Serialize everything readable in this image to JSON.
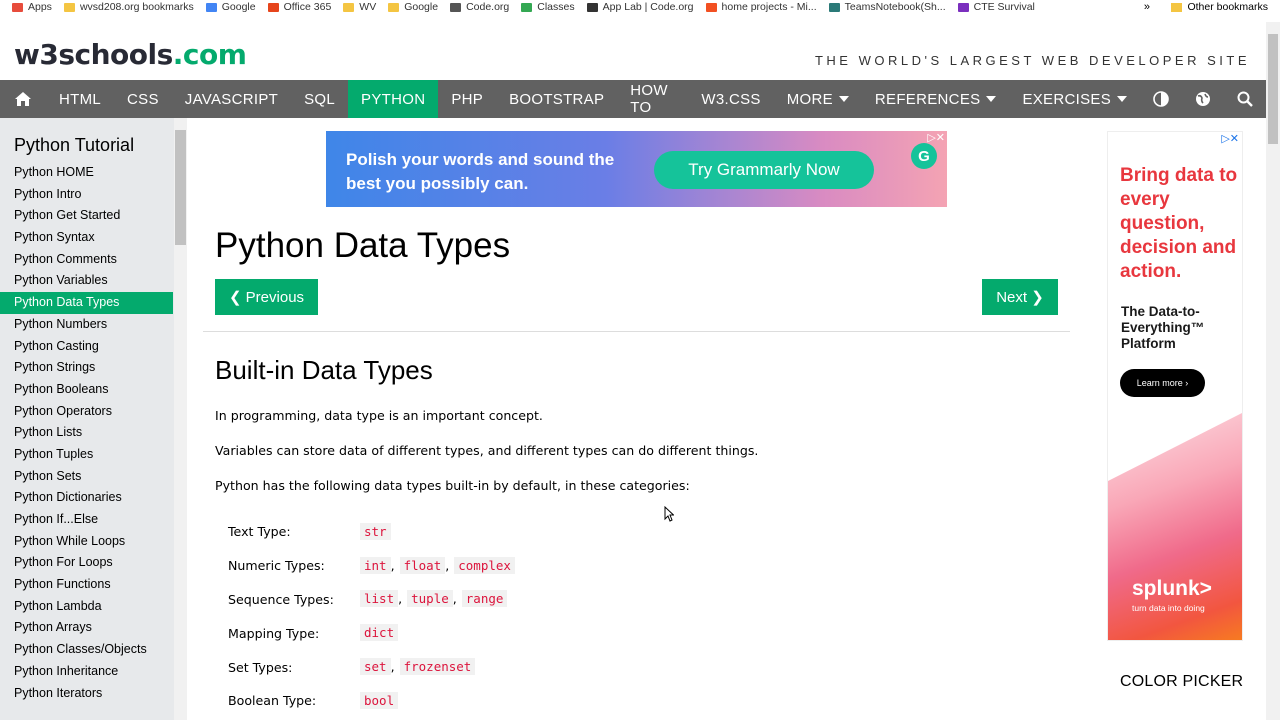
{
  "bookmarks": {
    "items": [
      {
        "label": "Apps",
        "color": "#e74c3c"
      },
      {
        "label": "wvsd208.org bookmarks",
        "color": "#f4c542"
      },
      {
        "label": "Google",
        "color": "#4285f4"
      },
      {
        "label": "Office 365",
        "color": "#e6451c"
      },
      {
        "label": "WV",
        "color": "#f4c542"
      },
      {
        "label": "Google",
        "color": "#f4c542"
      },
      {
        "label": "Code.org",
        "color": "#555555"
      },
      {
        "label": "Classes",
        "color": "#34a853"
      },
      {
        "label": "App Lab | Code.org",
        "color": "#333333"
      },
      {
        "label": "home projects - Mi...",
        "color": "#f25022"
      },
      {
        "label": "TeamsNotebook(Sh...",
        "color": "#2b7a78"
      },
      {
        "label": "CTE Survival",
        "color": "#7b2fbe"
      }
    ],
    "more": "»",
    "other": "Other bookmarks"
  },
  "header": {
    "logo_main": "w3schools",
    "logo_suffix": ".com",
    "tagline": "THE WORLD'S LARGEST WEB DEVELOPER SITE"
  },
  "nav": {
    "items": [
      "HTML",
      "CSS",
      "JAVASCRIPT",
      "SQL",
      "PYTHON",
      "PHP",
      "BOOTSTRAP",
      "HOW TO",
      "W3.CSS",
      "MORE"
    ],
    "references": "REFERENCES",
    "exercises": "EXERCISES"
  },
  "sidebar": {
    "title": "Python Tutorial",
    "links": [
      "Python HOME",
      "Python Intro",
      "Python Get Started",
      "Python Syntax",
      "Python Comments",
      "Python Variables",
      "Python Data Types",
      "Python Numbers",
      "Python Casting",
      "Python Strings",
      "Python Booleans",
      "Python Operators",
      "Python Lists",
      "Python Tuples",
      "Python Sets",
      "Python Dictionaries",
      "Python If...Else",
      "Python While Loops",
      "Python For Loops",
      "Python Functions",
      "Python Lambda",
      "Python Arrays",
      "Python Classes/Objects",
      "Python Inheritance",
      "Python Iterators"
    ]
  },
  "ad_top": {
    "text": "Polish your words and sound the best you possibly can.",
    "button": "Try Grammarly Now",
    "logo": "G"
  },
  "main": {
    "title": "Python Data Types",
    "prev": "❮ Previous",
    "next": "Next ❯",
    "heading": "Built-in Data Types",
    "p1": "In programming, data type is an important concept.",
    "p2": "Variables can store data of different types, and different types can do different things.",
    "p3": "Python has the following data types built-in by default, in these categories:",
    "rows": [
      {
        "label": "Text Type:",
        "codes": [
          "str"
        ]
      },
      {
        "label": "Numeric Types:",
        "codes": [
          "int",
          "float",
          "complex"
        ]
      },
      {
        "label": "Sequence Types:",
        "codes": [
          "list",
          "tuple",
          "range"
        ]
      },
      {
        "label": "Mapping Type:",
        "codes": [
          "dict"
        ]
      },
      {
        "label": "Set Types:",
        "codes": [
          "set",
          "frozenset"
        ]
      },
      {
        "label": "Boolean Type:",
        "codes": [
          "bool"
        ]
      }
    ]
  },
  "ad_right": {
    "headline": "Bring data to every question, decision and action.",
    "sub": "The Data-to-Everything™ Platform",
    "button": "Learn more ›",
    "brand": "splunk>",
    "brand_tag": "turn data into doing"
  },
  "right": {
    "color_picker": "COLOR PICKER"
  }
}
